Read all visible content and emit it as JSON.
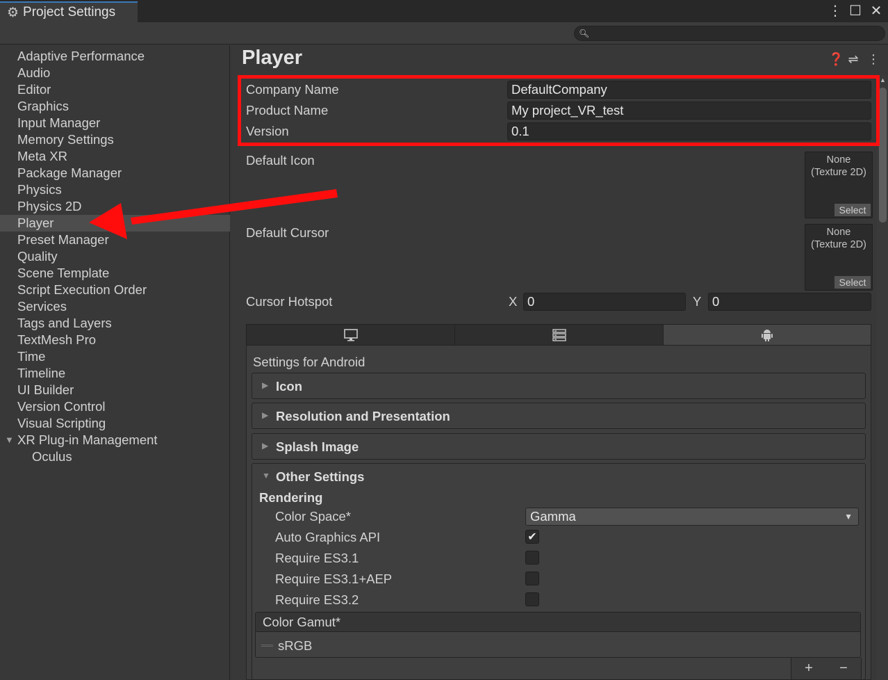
{
  "window": {
    "tab_title": "Project Settings",
    "controls": [
      "⋮",
      "☐",
      "✕"
    ]
  },
  "search": {
    "value": "",
    "placeholder": ""
  },
  "sidebar": {
    "items": [
      {
        "label": "Adaptive Performance"
      },
      {
        "label": "Audio"
      },
      {
        "label": "Editor"
      },
      {
        "label": "Graphics"
      },
      {
        "label": "Input Manager"
      },
      {
        "label": "Memory Settings"
      },
      {
        "label": "Meta XR"
      },
      {
        "label": "Package Manager"
      },
      {
        "label": "Physics"
      },
      {
        "label": "Physics 2D"
      },
      {
        "label": "Player",
        "selected": true
      },
      {
        "label": "Preset Manager"
      },
      {
        "label": "Quality"
      },
      {
        "label": "Scene Template"
      },
      {
        "label": "Script Execution Order"
      },
      {
        "label": "Services"
      },
      {
        "label": "Tags and Layers"
      },
      {
        "label": "TextMesh Pro"
      },
      {
        "label": "Time"
      },
      {
        "label": "Timeline"
      },
      {
        "label": "UI Builder"
      },
      {
        "label": "Version Control"
      },
      {
        "label": "Visual Scripting"
      },
      {
        "label": "XR Plug-in Management",
        "expanded": true
      },
      {
        "label": "Oculus",
        "child": true
      }
    ]
  },
  "main": {
    "title": "Player",
    "company_name": {
      "label": "Company Name",
      "value": "DefaultCompany"
    },
    "product_name": {
      "label": "Product Name",
      "value": "My project_VR_test"
    },
    "version": {
      "label": "Version",
      "value": "0.1"
    },
    "default_icon": {
      "label": "Default Icon",
      "slot_line1": "None",
      "slot_line2": "(Texture 2D)",
      "select": "Select"
    },
    "default_cursor": {
      "label": "Default Cursor",
      "slot_line1": "None",
      "slot_line2": "(Texture 2D)",
      "select": "Select"
    },
    "cursor_hotspot": {
      "label": "Cursor Hotspot",
      "x_label": "X",
      "x_value": "0",
      "y_label": "Y",
      "y_value": "0"
    },
    "platform_tabs": [
      {
        "icon": "monitor-icon",
        "active": false
      },
      {
        "icon": "server-icon",
        "active": false
      },
      {
        "icon": "android-icon",
        "active": true
      }
    ],
    "settings_for": "Settings for Android",
    "sections": {
      "icon": "Icon",
      "resolution": "Resolution and Presentation",
      "splash": "Splash Image",
      "other": "Other Settings"
    },
    "rendering": {
      "heading": "Rendering",
      "color_space_label": "Color Space*",
      "color_space_value": "Gamma",
      "auto_graphics_api": {
        "label": "Auto Graphics API",
        "checked": true
      },
      "require_es31": {
        "label": "Require ES3.1",
        "checked": false
      },
      "require_es31_aep": {
        "label": "Require ES3.1+AEP",
        "checked": false
      },
      "require_es32": {
        "label": "Require ES3.2",
        "checked": false
      },
      "color_gamut_label": "Color Gamut*",
      "color_gamut_items": [
        "sRGB"
      ],
      "list_add": "+",
      "list_remove": "−"
    }
  },
  "colors": {
    "highlight_box": "#ff1010",
    "arrow": "#ff0d0d",
    "tab_accent": "#3a79bb"
  }
}
